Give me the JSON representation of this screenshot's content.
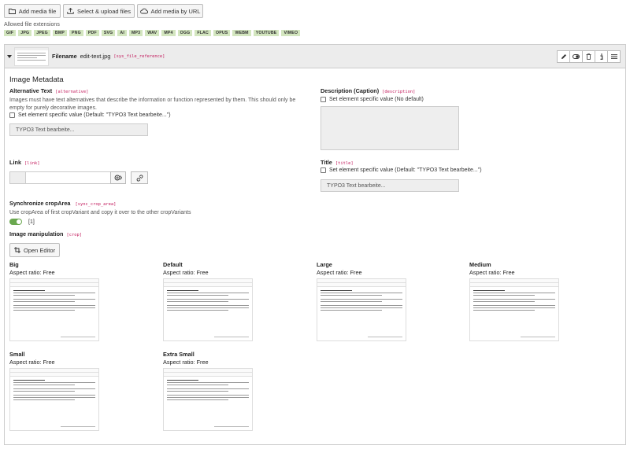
{
  "toolbar": {
    "add_media_file": "Add media file",
    "select_upload": "Select & upload files",
    "add_media_url": "Add media by URL"
  },
  "allowed": {
    "label": "Allowed file extensions",
    "extensions": [
      "GIF",
      "JPG",
      "JPEG",
      "BMP",
      "PNG",
      "PDF",
      "SVG",
      "AI",
      "MP3",
      "WAV",
      "MP4",
      "OGG",
      "FLAC",
      "OPUS",
      "WEBM",
      "YOUTUBE",
      "VIMEO"
    ]
  },
  "file": {
    "filename_label": "Filename",
    "filename": "edit-text.jpg",
    "table": "[sys_file_reference]"
  },
  "metadata": {
    "heading": "Image Metadata",
    "alt": {
      "label": "Alternative Text",
      "tag": "[alternative]",
      "help": "Images must have text alternatives that describe the information or function represented by them. This should only be empty for purely decorative images.",
      "checkbox": "Set element specific value (Default: \"TYPO3 Text bearbeite...\")",
      "value": "TYPO3 Text bearbeite..."
    },
    "description": {
      "label": "Description (Caption)",
      "tag": "[description]",
      "checkbox": "Set element specific value (No default)"
    },
    "link": {
      "label": "Link",
      "tag": "[link]"
    },
    "title": {
      "label": "Title",
      "tag": "[title]",
      "checkbox": "Set element specific value (Default: \"TYPO3 Text bearbeite...\")",
      "value": "TYPO3 Text bearbeite..."
    },
    "sync": {
      "label": "Synchronize cropArea",
      "tag": "[sync_crop_area]",
      "help": "Use cropArea of first cropVariant and copy it over to the other cropVariants",
      "value": "[1]"
    },
    "crop": {
      "label": "Image manipulation",
      "tag": "[crop]",
      "open_editor": "Open Editor",
      "variants": [
        {
          "name": "Big",
          "ratio": "Aspect ratio: Free"
        },
        {
          "name": "Default",
          "ratio": "Aspect ratio: Free"
        },
        {
          "name": "Large",
          "ratio": "Aspect ratio: Free"
        },
        {
          "name": "Medium",
          "ratio": "Aspect ratio: Free"
        },
        {
          "name": "Small",
          "ratio": "Aspect ratio: Free"
        },
        {
          "name": "Extra Small",
          "ratio": "Aspect ratio: Free"
        }
      ]
    }
  },
  "colors": {
    "extension_bg": "#d3e6bf",
    "tag": "#c2185b",
    "toggle_on": "#6aa84f"
  }
}
